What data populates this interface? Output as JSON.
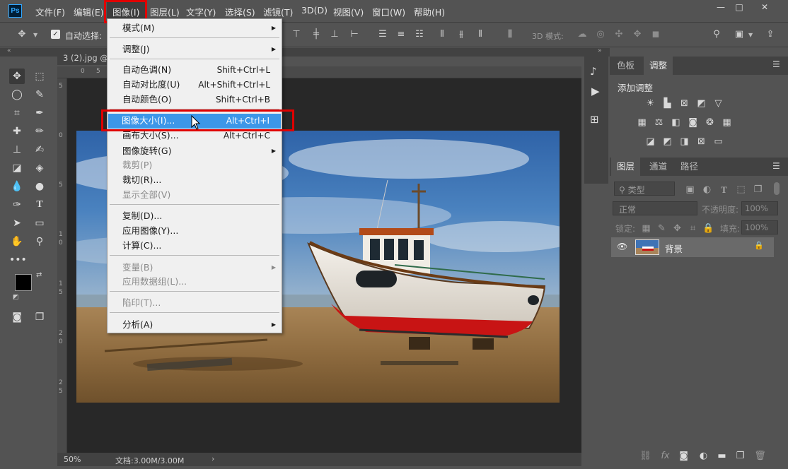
{
  "app": {
    "logo": "Ps"
  },
  "menubar": {
    "items": [
      "文件(F)",
      "编辑(E)",
      "图像(I)",
      "图层(L)",
      "文字(Y)",
      "选择(S)",
      "滤镜(T)",
      "3D(D)",
      "视图(V)",
      "窗口(W)",
      "帮助(H)"
    ],
    "window_controls": {
      "minimize": "—",
      "maximize": "□",
      "close": "✕"
    }
  },
  "options": {
    "auto_select_label": "自动选择:",
    "mode3d_label": "3D 模式:"
  },
  "document": {
    "tab_label": "3 (2).jpg @",
    "zoom": "50%",
    "doc_info": "文档:3.00M/3.00M",
    "ruler_top": [
      "0",
      "5",
      "10",
      "15"
    ],
    "ruler_left": [
      "5",
      "0",
      "5",
      "1",
      "0",
      "1",
      "5",
      "2",
      "0",
      "2",
      "5"
    ]
  },
  "dropdown": {
    "items": [
      {
        "label": "模式(M)",
        "shortcut": "",
        "submenu": true,
        "disabled": false
      },
      {
        "label": "调整(J)",
        "shortcut": "",
        "submenu": true,
        "disabled": false
      },
      {
        "label": "自动色调(N)",
        "shortcut": "Shift+Ctrl+L",
        "submenu": false,
        "disabled": false
      },
      {
        "label": "自动对比度(U)",
        "shortcut": "Alt+Shift+Ctrl+L",
        "submenu": false,
        "disabled": false
      },
      {
        "label": "自动颜色(O)",
        "shortcut": "Shift+Ctrl+B",
        "submenu": false,
        "disabled": false
      },
      {
        "label": "图像大小(I)...",
        "shortcut": "Alt+Ctrl+I",
        "submenu": false,
        "disabled": false,
        "highlighted": true
      },
      {
        "label": "画布大小(S)...",
        "shortcut": "Alt+Ctrl+C",
        "submenu": false,
        "disabled": false
      },
      {
        "label": "图像旋转(G)",
        "shortcut": "",
        "submenu": true,
        "disabled": false
      },
      {
        "label": "裁剪(P)",
        "shortcut": "",
        "submenu": false,
        "disabled": true
      },
      {
        "label": "裁切(R)...",
        "shortcut": "",
        "submenu": false,
        "disabled": false
      },
      {
        "label": "显示全部(V)",
        "shortcut": "",
        "submenu": false,
        "disabled": true
      },
      {
        "label": "复制(D)...",
        "shortcut": "",
        "submenu": false,
        "disabled": false
      },
      {
        "label": "应用图像(Y)...",
        "shortcut": "",
        "submenu": false,
        "disabled": false
      },
      {
        "label": "计算(C)...",
        "shortcut": "",
        "submenu": false,
        "disabled": false
      },
      {
        "label": "变量(B)",
        "shortcut": "",
        "submenu": true,
        "disabled": true
      },
      {
        "label": "应用数据组(L)...",
        "shortcut": "",
        "submenu": false,
        "disabled": true
      },
      {
        "label": "陷印(T)...",
        "shortcut": "",
        "submenu": false,
        "disabled": true
      },
      {
        "label": "分析(A)",
        "shortcut": "",
        "submenu": true,
        "disabled": false
      }
    ]
  },
  "panels": {
    "top_tabs": [
      "色板",
      "调整"
    ],
    "adjust_title": "添加调整",
    "layer_tabs": [
      "图层",
      "通道",
      "路径"
    ],
    "filter_label": "类型",
    "blend_mode": "正常",
    "opacity_label": "不透明度:",
    "opacity_value": "100%",
    "lock_label": "锁定:",
    "fill_label": "填充:",
    "fill_value": "100%",
    "layer_name": "背景"
  },
  "colors": {
    "accent": "#3d97e8",
    "annotation": "#e00000",
    "panel": "#535353"
  }
}
